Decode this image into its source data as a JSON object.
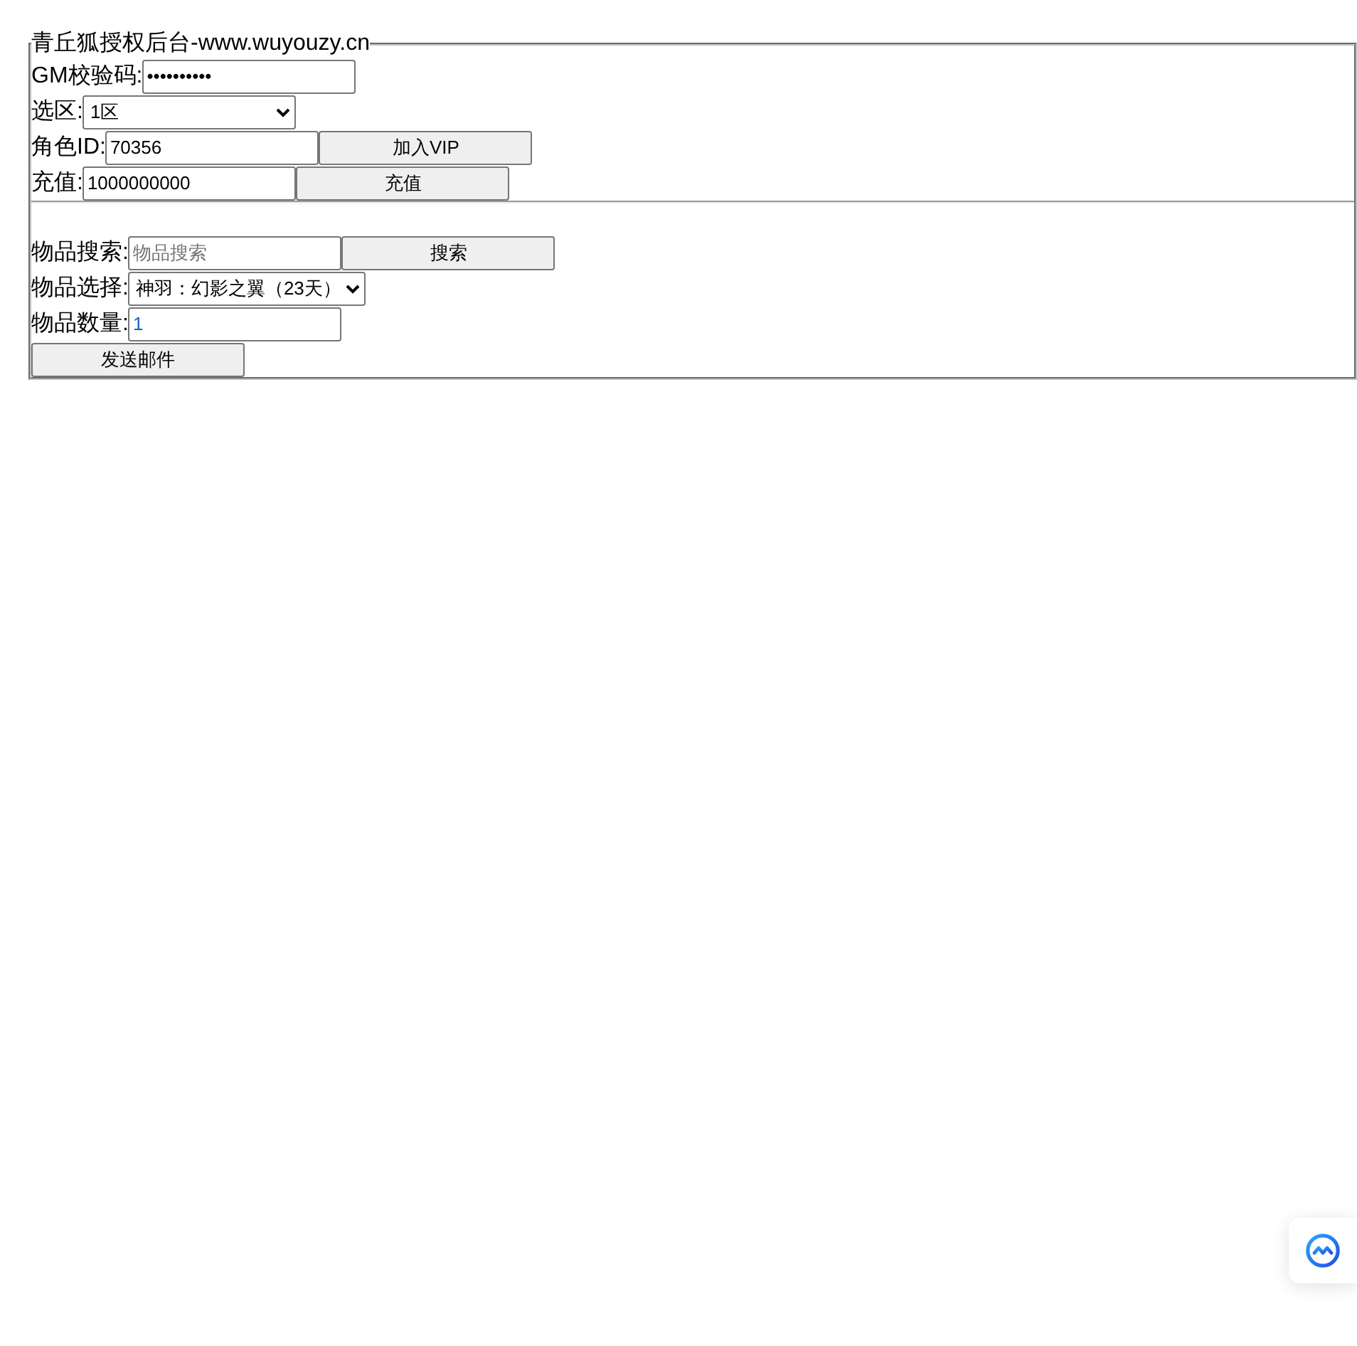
{
  "form": {
    "legend": "青丘狐授权后台-www.wuyouzy.cn"
  },
  "account_rows": [
    {
      "kind": "password",
      "label": "GM校验码:",
      "value": "••••••••••"
    },
    {
      "kind": "select",
      "label": "选区:",
      "value": "1区"
    },
    {
      "kind": "text",
      "label": "角色ID:",
      "value": "70356",
      "button": "加入VIP"
    },
    {
      "kind": "text",
      "label": "充值:",
      "value": "1000000000",
      "button": "充值"
    }
  ],
  "item_rows": [
    {
      "kind": "text",
      "label": "物品搜索:",
      "placeholder": "物品搜索",
      "button": "搜索"
    },
    {
      "kind": "select",
      "label": "物品选择:",
      "value": "神羽：幻影之翼（23天）"
    },
    {
      "kind": "number",
      "label": "物品数量:",
      "value": "1"
    }
  ],
  "send_button": "发送邮件"
}
